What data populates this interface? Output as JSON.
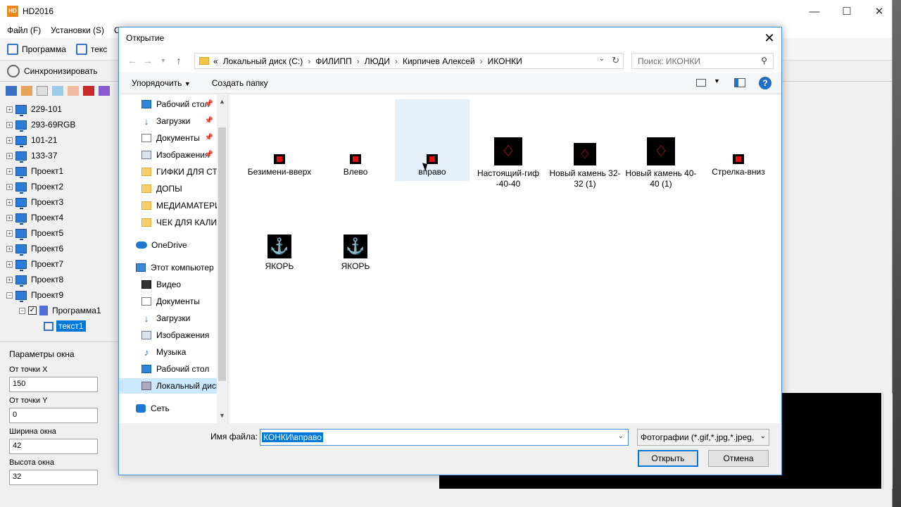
{
  "app": {
    "title": "HD2016",
    "logo_text": "HD",
    "menu": [
      "Файл (F)",
      "Установки (S)",
      "О"
    ],
    "toolbar": {
      "program": "Программа",
      "text": "текс"
    },
    "sync": "Синхронизировать",
    "tree": [
      {
        "label": "229-101"
      },
      {
        "label": "293-69RGB"
      },
      {
        "label": "101-21"
      },
      {
        "label": "133-37"
      },
      {
        "label": "Проект1"
      },
      {
        "label": "Проект2"
      },
      {
        "label": "Проект3"
      },
      {
        "label": "Проект4"
      },
      {
        "label": "Проект5"
      },
      {
        "label": "Проект6"
      },
      {
        "label": "Проект7"
      },
      {
        "label": "Проект8"
      },
      {
        "label": "Проект9"
      }
    ],
    "program_node": "Программа1",
    "text_node": "текст1",
    "params": {
      "title": "Параметры окна",
      "x_label": "От точки X",
      "x_value": "150",
      "y_label": "От точки Y",
      "y_value": "0",
      "w_label": "Ширина окна",
      "w_value": "42",
      "h_label": "Высота окна",
      "h_value": "32"
    }
  },
  "dialog": {
    "title": "Открытие",
    "breadcrumb": [
      "«",
      "Локальный диск (C:)",
      "ФИЛИПП",
      "ЛЮДИ",
      "Кирпичев Алексей",
      "ИКОНКИ"
    ],
    "search_placeholder": "Поиск: ИКОНКИ",
    "organize": "Упорядочить",
    "new_folder": "Создать папку",
    "nav": {
      "quick": [
        {
          "label": "Рабочий стол",
          "pinned": true
        },
        {
          "label": "Загрузки",
          "pinned": true
        },
        {
          "label": "Документы",
          "pinned": true
        },
        {
          "label": "Изображения",
          "pinned": true
        },
        {
          "label": "ГИФКИ ДЛЯ СТ"
        },
        {
          "label": "ДОПЫ"
        },
        {
          "label": "МЕДИАМАТЕРИ"
        },
        {
          "label": "ЧЕК ДЛЯ КАЛИН"
        }
      ],
      "onedrive": "OneDrive",
      "this_pc": "Этот компьютер",
      "pc_items": [
        "Видео",
        "Документы",
        "Загрузки",
        "Изображения",
        "Музыка",
        "Рабочий стол",
        "Локальный диск"
      ],
      "network": "Сеть"
    },
    "files": [
      {
        "label": "Безимени-вверх"
      },
      {
        "label": "Влево"
      },
      {
        "label": "вправо"
      },
      {
        "label": "Настоящий-гиф -40-40"
      },
      {
        "label": "Новый камень 32-32 (1)"
      },
      {
        "label": "Новый камень 40-40 (1)"
      },
      {
        "label": "Стрелка-вниз"
      },
      {
        "label": "ЯКОРЬ"
      },
      {
        "label": "ЯКОРЬ"
      }
    ],
    "filename_label": "Имя файла:",
    "filename_value": "КОНКИ\\вправо",
    "filetype": "Фотографии (*.gif,*.jpg,*.jpeg,",
    "open_button": "Открыть",
    "cancel_button": "Отмена"
  }
}
